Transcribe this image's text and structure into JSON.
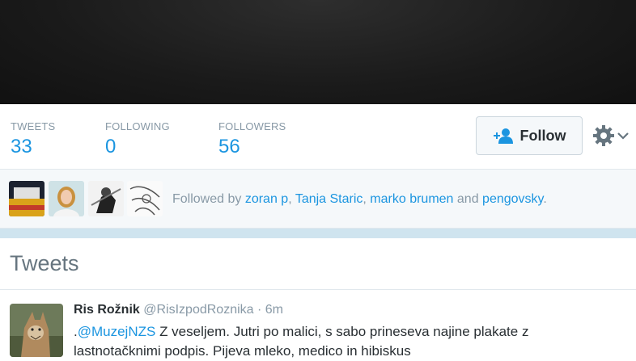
{
  "stats": [
    {
      "label": "TWEETS",
      "value": "33"
    },
    {
      "label": "FOLLOWING",
      "value": "0"
    },
    {
      "label": "FOLLOWERS",
      "value": "56"
    }
  ],
  "follow_button": {
    "label": "Follow",
    "icon": "add-person-icon"
  },
  "settings": {
    "icon": "gear-icon",
    "caret": "chevron-down-icon"
  },
  "followed_by": {
    "prefix": "Followed by",
    "users": [
      "zoran p",
      "Tanja Staric",
      "marko brumen",
      "pengovsky"
    ],
    "sep1": ", ",
    "sep2": ", ",
    "conj": " and ",
    "suffix": "."
  },
  "tweets_heading": "Tweets",
  "tweet": {
    "name": "Ris Rožnik",
    "handle": "@RisIzpodRoznika",
    "sep": "·",
    "time": "6m",
    "mention_prefix": ".",
    "mention": "@MuzejNZS",
    "text_line1": " Z veseljem. Jutri po malici, s sabo prineseva najine plakate z",
    "text_line2": "lastnotačknimi podpis. Pijeva mleko, medico in hibiskus"
  },
  "colors": {
    "accent": "#1b95e0",
    "muted": "#8899a6",
    "header": "#1a1a1a"
  }
}
